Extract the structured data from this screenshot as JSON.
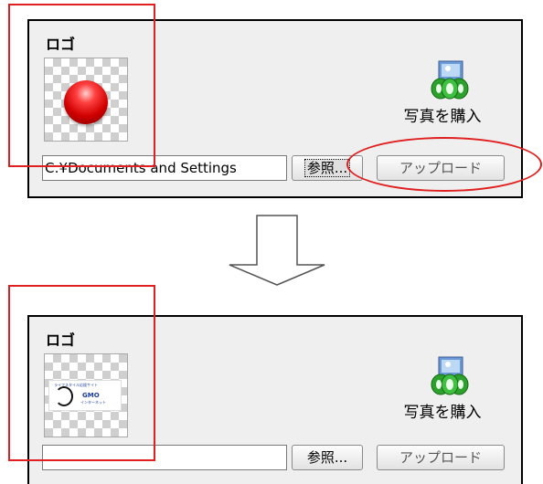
{
  "before": {
    "logo_label": "ロゴ",
    "thumbnail_icon": "red-ball-icon",
    "buy_photo_label": "写真を購入",
    "file_path_value": "C:¥Documents and Settings",
    "browse_label": "参照...",
    "upload_label": "アップロード"
  },
  "after": {
    "logo_label": "ロゴ",
    "thumbnail_image_text": {
      "line1": "ライフスタイル応援サイト",
      "brand": "GMO",
      "line2": "インターネット"
    },
    "buy_photo_label": "写真を購入",
    "file_path_value": "",
    "browse_label": "参照...",
    "upload_label": "アップロード"
  },
  "icons": {
    "buy_photo": "buy-photo-icon",
    "transition": "down-arrow-icon"
  },
  "colors": {
    "highlight": "#e02020",
    "panel_bg": "#efefef"
  }
}
